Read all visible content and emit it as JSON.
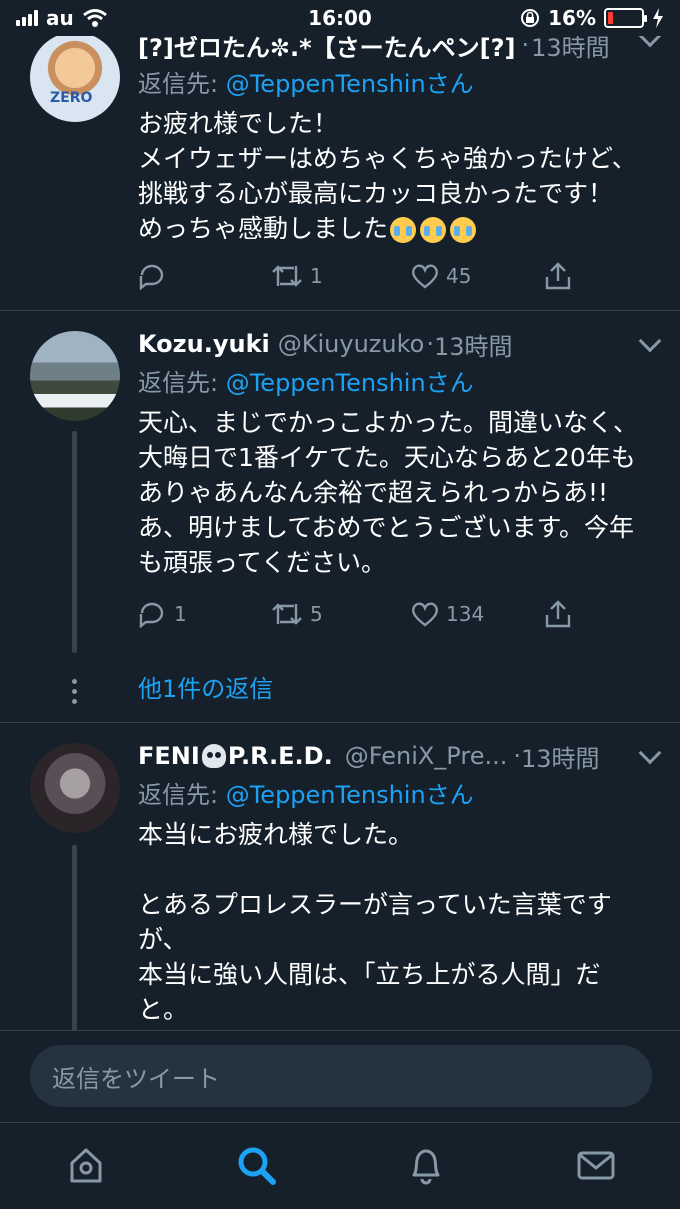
{
  "status_bar": {
    "carrier": "au",
    "time": "16:00",
    "battery_percent": "16%",
    "battery_level": 0.16
  },
  "tweets": [
    {
      "display_name": "[?]ゼロたん✼.*【さーたんペン[?]",
      "handle": "",
      "sep": "·",
      "time": "13時間",
      "reply_prefix": "返信先: ",
      "reply_mention": "@TeppenTenshin",
      "reply_suffix": "さん",
      "body": "お疲れ様でした！\nメイウェザーはめちゃくちゃ強かったけど、\n挑戦する心が最高にカッコ良かったです！\nめっちゃ感動しました",
      "replies": "",
      "retweets": "1",
      "likes": "45"
    },
    {
      "display_name": "Kozu.yuki",
      "handle": "@Kiuyuzuko",
      "sep": "·",
      "time": "13時間",
      "reply_prefix": "返信先: ",
      "reply_mention": "@TeppenTenshin",
      "reply_suffix": "さん",
      "body": "天心、まじでかっこよかった。間違いなく、\n大晦日で1番イケてた。天心ならあと20年も\nありゃあんなん余裕で超えられっからあ!!\nあ、明けましておめでとうございます。今年\nも頑張ってください。",
      "replies": "1",
      "retweets": "5",
      "likes": "134",
      "more_replies": "他1件の返信"
    },
    {
      "display_name_a": "FENI",
      "display_name_b": "P.R.E.D.",
      "handle": "@FeniX_Pre...",
      "sep": "·",
      "time": "13時間",
      "reply_prefix": "返信先: ",
      "reply_mention": "@TeppenTenshin",
      "reply_suffix": "さん",
      "body": "本当にお疲れ様でした。\n\nとあるプロレスラーが言っていた言葉です\nが、\n本当に強い人間は、「立ち上がる人間」だ\nと。"
    }
  ],
  "composer": {
    "placeholder": "返信をツイート"
  },
  "tabs": [
    "home-icon",
    "search-icon",
    "notifications-icon",
    "messages-icon"
  ],
  "colors": {
    "background": "#15202b",
    "accent": "#1da1f2",
    "secondary_text": "#8899a6",
    "divider": "#38444d"
  }
}
